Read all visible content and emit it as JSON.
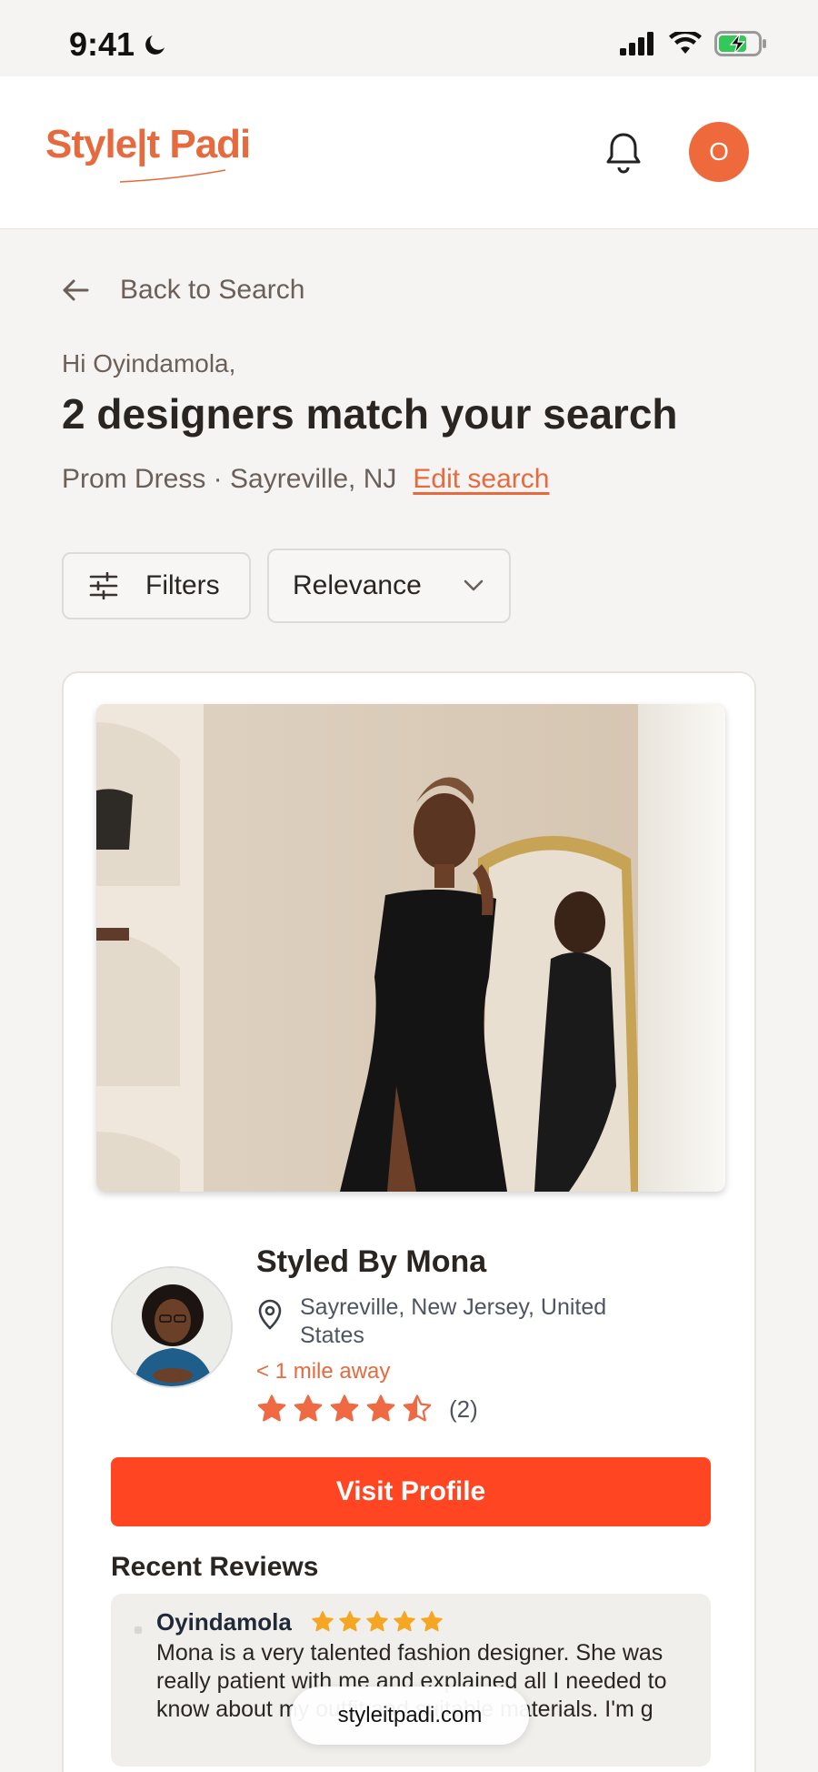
{
  "status_bar": {
    "time": "9:41"
  },
  "header": {
    "logo_text": "Style|t Padi",
    "avatar_initial": "O"
  },
  "nav": {
    "back_label": "Back to Search"
  },
  "summary": {
    "greeting": "Hi Oyindamola,",
    "title": "2 designers match your search",
    "query": "Prom Dress · Sayreville, NJ",
    "edit_label": "Edit search"
  },
  "controls": {
    "filters_label": "Filters",
    "sort_value": "Relevance"
  },
  "designer": {
    "name": "Styled By Mona",
    "location_line1": "Sayreville, New Jersey, United",
    "location_line2": "States",
    "distance": "< 1 mile away",
    "rating": 4.5,
    "review_count": "(2)",
    "visit_label": "Visit Profile"
  },
  "reviews": {
    "section_title": "Recent Reviews",
    "items": [
      {
        "reviewer": "Oyindamola",
        "stars": 5,
        "text": "Mona is a very talented fashion designer. She was really patient with me and explained all I needed to know about my outfit and suitable materials. I'm g"
      }
    ]
  },
  "browser": {
    "url": "styleitpadi.com"
  },
  "colors": {
    "brand": "#e66a3e",
    "cta": "#ff4521",
    "star_rating": "#ef6a42",
    "star_review": "#f5a623"
  }
}
